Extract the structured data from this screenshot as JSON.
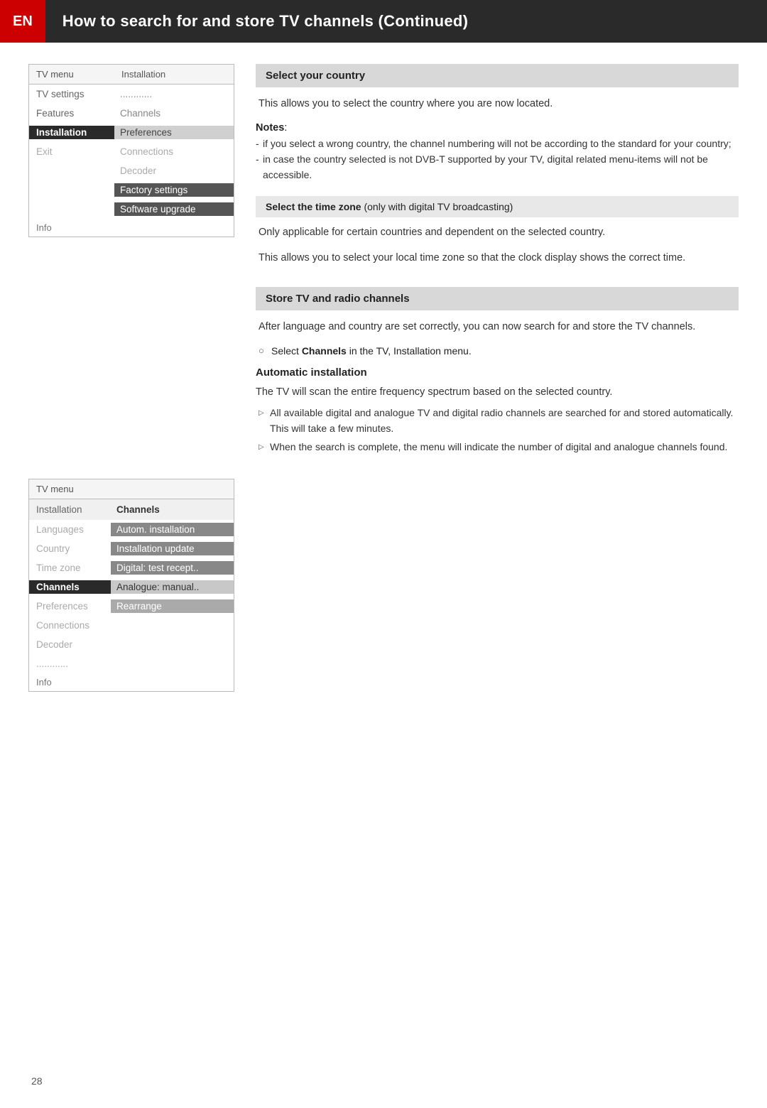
{
  "header": {
    "en_label": "EN",
    "title": "How to search for and store TV channels  (Continued)"
  },
  "menu1": {
    "col1_header": "TV menu",
    "col2_header": "Installation",
    "rows": [
      {
        "col1": "TV settings",
        "col2": "............",
        "style": "normal"
      },
      {
        "col1": "Features",
        "col2": "Channels",
        "style": "normal"
      },
      {
        "col1": "Installation",
        "col2": "Preferences",
        "style": "active"
      },
      {
        "col1": "Exit",
        "col2": "Connections",
        "style": "normal"
      },
      {
        "col1": "",
        "col2": "Decoder",
        "style": "normal"
      },
      {
        "col1": "",
        "col2": "Factory settings",
        "style": "highlight"
      },
      {
        "col1": "",
        "col2": "Software upgrade",
        "style": "highlight"
      }
    ],
    "info": "Info"
  },
  "menu2": {
    "col1_header": "TV menu",
    "col2_header": "",
    "subheader": "Channels",
    "rows": [
      {
        "col1": "Installation",
        "col2": "Channels",
        "style": "normal"
      },
      {
        "col1": "Languages",
        "col2": "Autom. installation",
        "style": "highlight"
      },
      {
        "col1": "Country",
        "col2": "Installation update",
        "style": "highlight"
      },
      {
        "col1": "Time zone",
        "col2": "Digital: test recept..",
        "style": "highlight"
      },
      {
        "col1": "Channels",
        "col2": "Analogue: manual..",
        "style": "active-channels"
      },
      {
        "col1": "Preferences",
        "col2": "Rearrange",
        "style": "selected"
      },
      {
        "col1": "Connections",
        "col2": "",
        "style": "normal"
      },
      {
        "col1": "Decoder",
        "col2": "",
        "style": "normal"
      },
      {
        "col1": "............",
        "col2": "",
        "style": "dotted"
      }
    ],
    "info": "Info"
  },
  "section1": {
    "title": "Select your country",
    "body": "This allows you to select the country where you are now located.",
    "notes_label": "Notes",
    "notes": [
      "if you select a wrong country, the channel numbering will not be according to the standard for your country;",
      "in case the country selected is not DVB-T supported by your TV, digital related menu-items will not be accessible."
    ]
  },
  "section2": {
    "title_strong": "Select the time zone",
    "title_suffix": " (only with digital TV broadcasting)",
    "body1": "Only applicable for certain countries and dependent on the selected country.",
    "body2": "This allows you to select your local time zone so that the clock display shows the correct time."
  },
  "section3": {
    "title": "Store TV and radio channels",
    "body": "After language and country are set correctly, you can now search for and store the TV channels.",
    "select_line_prefix": "Select ",
    "select_line_bold": "Channels",
    "select_line_suffix": " in the TV, Installation menu.",
    "auto_install_title": "Automatic installation",
    "auto_install_body": "The TV will scan the entire frequency spectrum based on the selected country.",
    "bullets": [
      "All available digital and analogue TV and digital radio channels are searched for and stored automatically. This will take a few minutes.",
      "When the search is complete, the menu will indicate the number of digital and analogue channels found."
    ]
  },
  "page_number": "28"
}
